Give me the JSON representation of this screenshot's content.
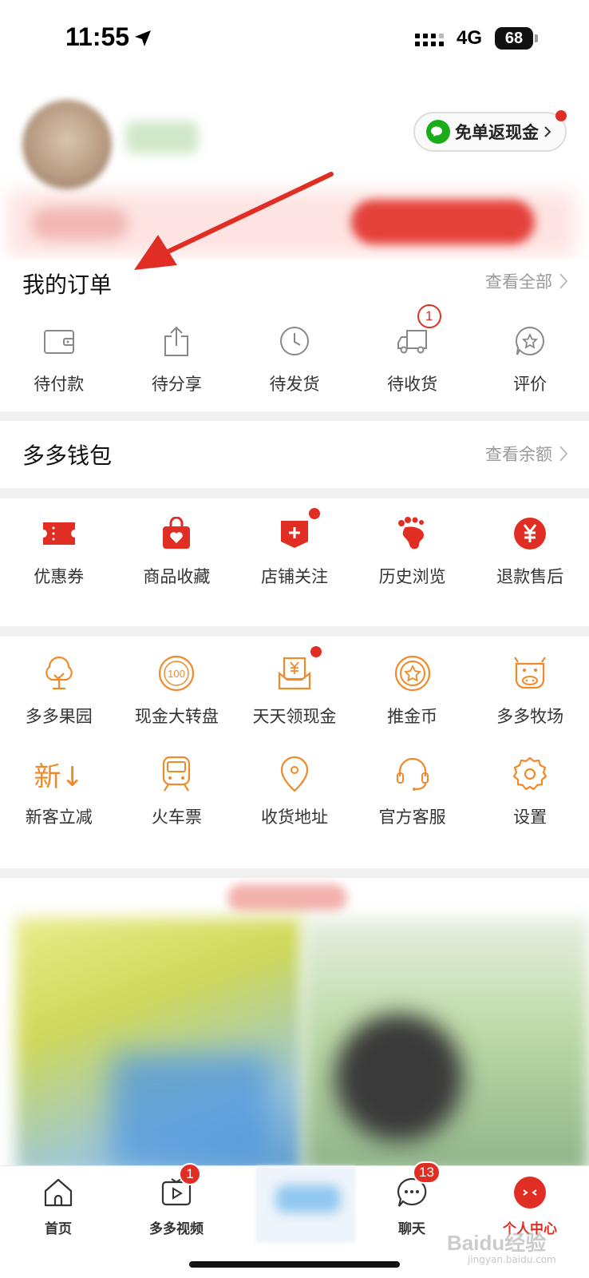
{
  "status_bar": {
    "time": "11:55",
    "network": "4G",
    "battery": "68"
  },
  "header": {
    "cashback_label": "免单返现金"
  },
  "orders": {
    "title": "我的订单",
    "view_all": "查看全部",
    "items": [
      {
        "label": "待付款",
        "icon": "wallet-icon"
      },
      {
        "label": "待分享",
        "icon": "share-icon"
      },
      {
        "label": "待发货",
        "icon": "clock-icon"
      },
      {
        "label": "待收货",
        "icon": "truck-icon",
        "badge": "1"
      },
      {
        "label": "评价",
        "icon": "review-icon"
      }
    ]
  },
  "wallet": {
    "title": "多多钱包",
    "view_balance": "查看余额"
  },
  "quick_links": [
    {
      "label": "优惠券",
      "icon": "coupon-icon"
    },
    {
      "label": "商品收藏",
      "icon": "favorite-bag-icon"
    },
    {
      "label": "店铺关注",
      "icon": "store-follow-icon",
      "dot": true
    },
    {
      "label": "历史浏览",
      "icon": "footprint-icon"
    },
    {
      "label": "退款售后",
      "icon": "refund-icon"
    }
  ],
  "tools": {
    "row1": [
      {
        "label": "多多果园",
        "icon": "tree-icon"
      },
      {
        "label": "现金大转盘",
        "icon": "wheel-100-icon"
      },
      {
        "label": "天天领现金",
        "icon": "cash-envelope-icon",
        "dot": true
      },
      {
        "label": "推金币",
        "icon": "coin-icon"
      },
      {
        "label": "多多牧场",
        "icon": "cow-icon"
      }
    ],
    "row2": [
      {
        "label": "新客立减",
        "icon": "new-discount-icon",
        "glyph": "新↓"
      },
      {
        "label": "火车票",
        "icon": "train-icon"
      },
      {
        "label": "收货地址",
        "icon": "location-pin-icon"
      },
      {
        "label": "官方客服",
        "icon": "headset-icon"
      },
      {
        "label": "设置",
        "icon": "settings-gear-icon"
      }
    ]
  },
  "bottom_nav": [
    {
      "label": "首页",
      "icon": "home-icon"
    },
    {
      "label": "多多视频",
      "icon": "video-icon",
      "badge": "1"
    },
    {
      "label": "",
      "icon": "center-promo-icon"
    },
    {
      "label": "聊天",
      "icon": "chat-icon",
      "badge": "13"
    },
    {
      "label": "个人中心",
      "icon": "profile-icon",
      "active": true
    }
  ],
  "watermark": {
    "text": "Baidu经验",
    "sub": "jingyan.baidu.com"
  },
  "colors": {
    "brand_red": "#e02e24",
    "tool_orange": "#f08a28",
    "wechat_green": "#1aad19"
  }
}
